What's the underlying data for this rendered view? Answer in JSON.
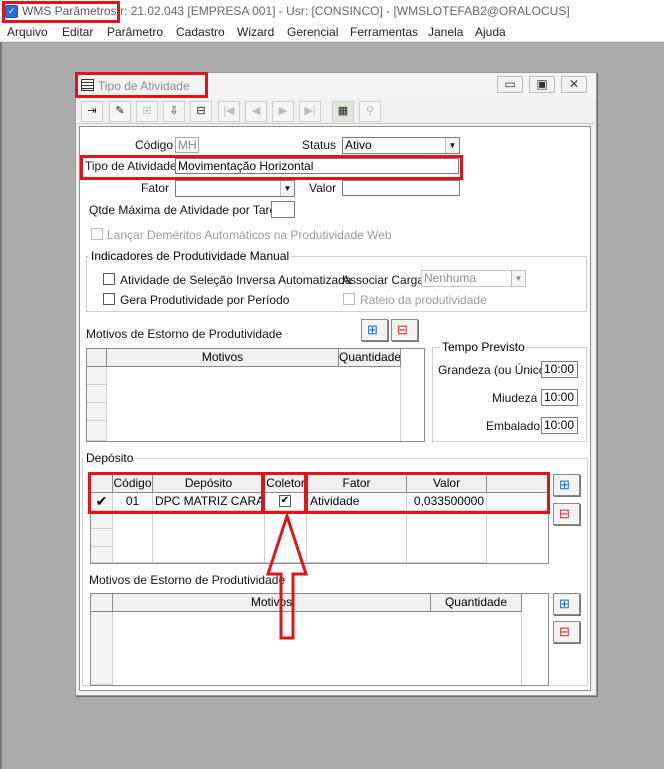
{
  "app": {
    "title_highlight": "WMS Parâmetros",
    "title_rest": "r: 21.02.043   [EMPRESA 001] - Usr: [CONSINCO] - [WMSLOTEFAB2@ORALOCUS]"
  },
  "menu": [
    "Arquivo",
    "Editar",
    "Parâmetro",
    "Cadastro",
    "Wizard",
    "Gerencial",
    "Ferramentas",
    "Janela",
    "Ajuda"
  ],
  "window": {
    "title": "Tipo de Atividade",
    "min": "▭",
    "max": "▣",
    "close": "✕"
  },
  "form": {
    "codigo_label": "Código",
    "codigo_value": "MH",
    "status_label": "Status",
    "status_value": "Ativo",
    "tipo_label": "Tipo de Atividade",
    "tipo_value": "Movimentação Horizontal",
    "fator_label": "Fator",
    "valor_label": "Valor",
    "qtde_label": "Qtde Máxima de Atividade por Tarefa",
    "lancar_label": "Lançar Deméritos Automáticos na Produtividade Web"
  },
  "indicadores": {
    "caption": "Indicadores de Produtividade Manual",
    "selecao_label": "Atividade de Seleção Inversa Automatizada",
    "associar_label": "Associar Carga",
    "associar_value": "Nenhuma",
    "gera_label": "Gera Produtividade por Período",
    "rateio_label": "Rateio da produtividade"
  },
  "motivos1": {
    "title": "Motivos de Estorno de Produtividade",
    "col_motivos": "Motivos",
    "col_quantidade": "Quantidade"
  },
  "tempo": {
    "caption": "Tempo Previsto",
    "grandeza_label": "Grandeza (ou Único)",
    "grandeza_value": "10:00",
    "miudeza_label": "Miudeza",
    "miudeza_value": "10:00",
    "embalado_label": "Embalado",
    "embalado_value": "10:00"
  },
  "deposito": {
    "caption": "Depósito",
    "headers": {
      "codigo": "Código",
      "deposito": "Depósito",
      "coletor": "Coletor",
      "fator": "Fator",
      "valor": "Valor"
    },
    "row": {
      "marker": "✔",
      "codigo": "01",
      "deposito": "DPC MATRIZ CARATI",
      "coletor": "✔",
      "fator": "Atividade",
      "valor": "0,033500000"
    }
  },
  "motivos2": {
    "title": "Motivos de Estorno de Produtividade",
    "col_motivos": "Motivos",
    "col_quantidade": "Quantidade"
  },
  "colors": {
    "highlight": "#e0141c",
    "arrow": "#e0141c"
  }
}
